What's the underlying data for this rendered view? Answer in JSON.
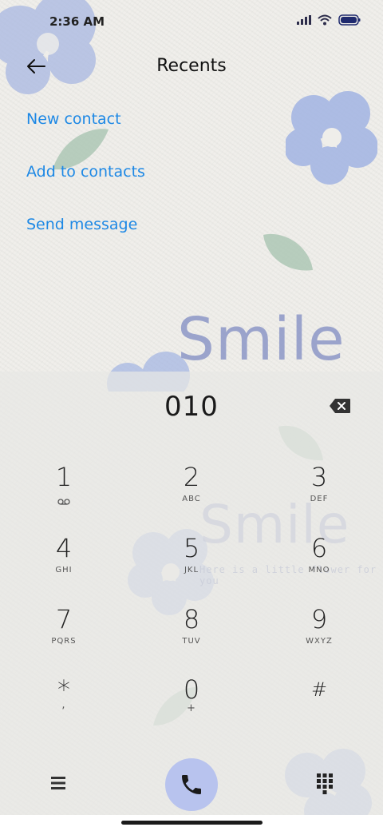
{
  "status_bar": {
    "time": "2:36 AM",
    "icons": [
      "signal-icon",
      "wifi-icon",
      "battery-icon"
    ]
  },
  "header": {
    "title": "Recents",
    "back_icon": "arrow-left-icon"
  },
  "actions": {
    "new_contact": "New contact",
    "add_to_contacts": "Add to contacts",
    "send_message": "Send message"
  },
  "wallpaper": {
    "text_large": "Smile",
    "text_small": "Here is a little flower for you"
  },
  "dialer": {
    "number": "010",
    "keys": [
      {
        "digit": "1",
        "letters": "",
        "icon": "voicemail-icon"
      },
      {
        "digit": "2",
        "letters": "ABC"
      },
      {
        "digit": "3",
        "letters": "DEF"
      },
      {
        "digit": "4",
        "letters": "GHI"
      },
      {
        "digit": "5",
        "letters": "JKL"
      },
      {
        "digit": "6",
        "letters": "MNO"
      },
      {
        "digit": "7",
        "letters": "PQRS"
      },
      {
        "digit": "8",
        "letters": "TUV"
      },
      {
        "digit": "9",
        "letters": "WXYZ"
      },
      {
        "digit": "*",
        "letters": ","
      },
      {
        "digit": "0",
        "letters": "+"
      },
      {
        "digit": "#",
        "letters": ""
      }
    ]
  },
  "colors": {
    "accent": "#1d88e5",
    "call_button": "#b8c3ee",
    "flower": "#9eb0e0",
    "leaf": "#a9c4b2"
  }
}
